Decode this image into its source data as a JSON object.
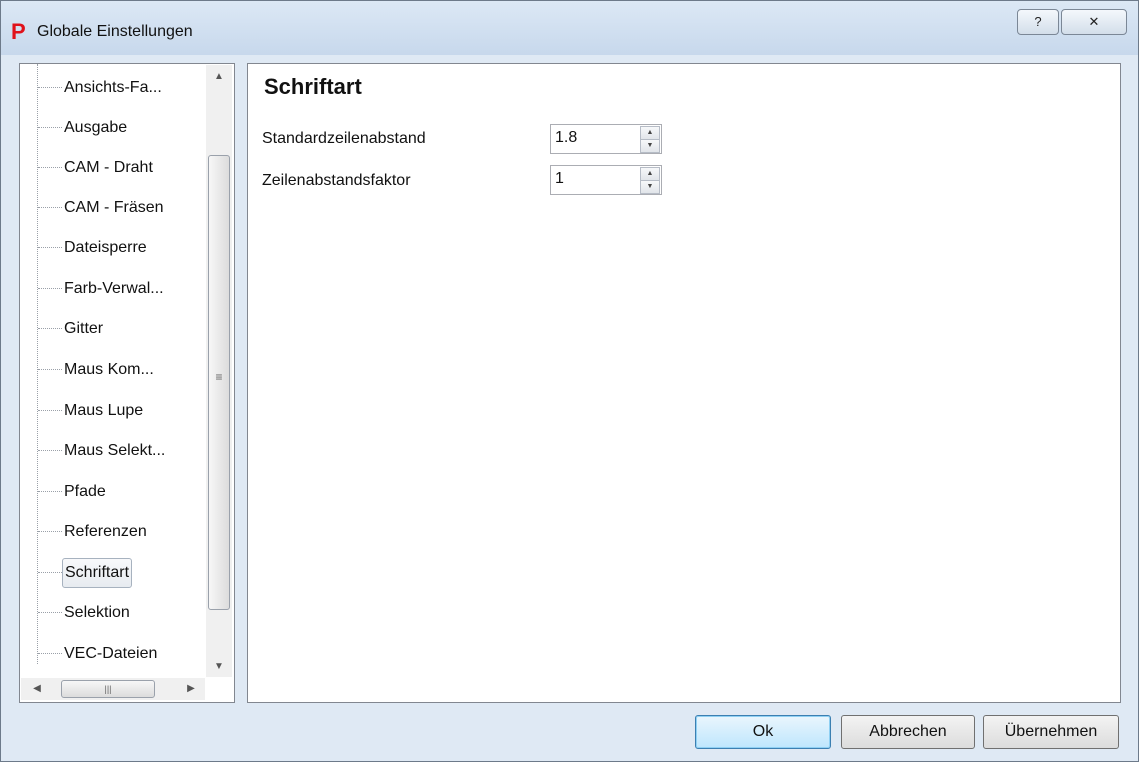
{
  "window": {
    "title": "Globale Einstellungen",
    "app_icon": "P",
    "help_label": "?",
    "close_label": "✕"
  },
  "tree": {
    "items": [
      {
        "label": "Ansichts-Fa..."
      },
      {
        "label": "Ausgabe"
      },
      {
        "label": "CAM - Draht"
      },
      {
        "label": "CAM - Fräsen"
      },
      {
        "label": "Dateisperre"
      },
      {
        "label": "Farb-Verwal..."
      },
      {
        "label": "Gitter"
      },
      {
        "label": "Maus Kom..."
      },
      {
        "label": "Maus Lupe"
      },
      {
        "label": "Maus Selekt..."
      },
      {
        "label": "Pfade"
      },
      {
        "label": "Referenzen"
      },
      {
        "label": "Schriftart"
      },
      {
        "label": "Selektion"
      },
      {
        "label": "VEC-Dateien"
      }
    ],
    "selected": "Schriftart"
  },
  "content": {
    "section_title": "Schriftart",
    "fields": [
      {
        "label": "Standardzeilenabstand",
        "value": "1.8"
      },
      {
        "label": "Zeilenabstandsfaktor",
        "value": "1"
      }
    ]
  },
  "buttons": {
    "ok": "Ok",
    "cancel": "Abbrechen",
    "apply": "Übernehmen"
  },
  "colors": {
    "app_icon": "#e0121b",
    "ok_border": "#3c7fb1"
  }
}
